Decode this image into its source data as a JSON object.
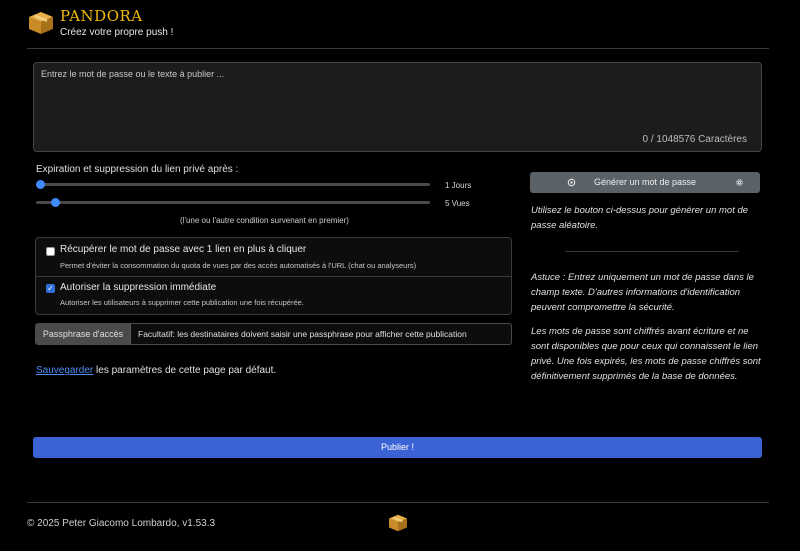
{
  "app": {
    "name": "PANDORA",
    "tagline": "Créez votre propre push !"
  },
  "editor": {
    "placeholder": "Entrez le mot de passe ou le texte à publier ...",
    "counter": "0 / 1048576 Caractères"
  },
  "expiration": {
    "label": "Expiration et suppression du lien privé après :",
    "days": {
      "value_text": "1 Jours",
      "fraction": 0.0
    },
    "views": {
      "value_text": "5 Vues",
      "fraction": 0.04
    },
    "note": "(l'une ou l'autre condition survenant en premier)"
  },
  "options": {
    "retrieval": {
      "title": "Récupérer le mot de passe avec 1 lien en plus à cliquer",
      "desc": "Permet d'éviter la consommation du quota de vues par des accès automatisés à l'URL (chat ou analyseurs)",
      "checked": false
    },
    "deletion": {
      "title": "Autoriser la suppression immédiate",
      "desc": "Autoriser les utilisateurs à supprimer cette publication une fois récupérée.",
      "checked": true
    }
  },
  "passphrase": {
    "label": "Passphrase d'accès",
    "placeholder": "Facultatif: les destinataires doivent saisir une passphrase pour afficher cette publication"
  },
  "save": {
    "link": "Sauvegarder",
    "rest": " les paramètres de cette page par défaut."
  },
  "generator": {
    "button_label": "Générer un mot de passe",
    "help": "Utilisez le bouton ci-dessus pour générer un mot de passe aléatoire."
  },
  "tips": {
    "tip1": "Astuce : Entrez uniquement un mot de passe dans le champ texte. D'autres informations d'identification peuvent compromettre la sécurité.",
    "tip2": "Les mots de passe sont chiffrés avant écriture et ne sont disponibles que pour ceux qui connaissent le lien privé. Une fois expirés, les mots de passe chiffrés sont définitivement supprimés de la base de données."
  },
  "publish": {
    "label": "Publier !"
  },
  "footer": {
    "copyright": "© 2025 Peter Giacomo Lombardo, v1.53.3"
  },
  "icons": {
    "logo": "box-icon",
    "generate_left": "sync-icon",
    "generate_right": "gear-icon",
    "check": "check-icon"
  },
  "colors": {
    "brand": "#f0b90b",
    "accent": "#3d8bfd",
    "publish": "#3c63d6",
    "link": "#4f8ef7"
  }
}
